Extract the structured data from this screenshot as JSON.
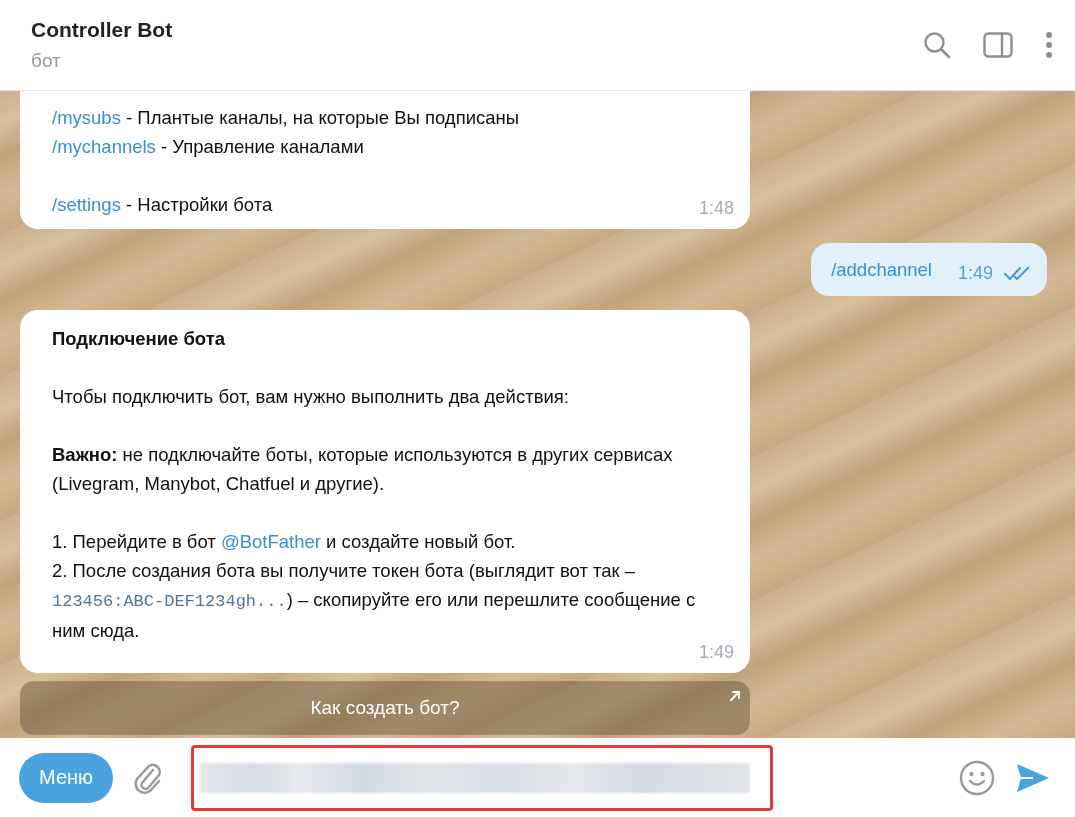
{
  "header": {
    "title": "Controller Bot",
    "subtitle": "бот"
  },
  "messages": [
    {
      "kind": "incoming",
      "paragraphs": [
        [
          {
            "kind": "command",
            "segments": [
              {
                "kind": "link",
                "text": "/mysubs"
              },
              {
                "kind": "text",
                "text": " - Плантые каналы, на которые Вы подписаны"
              }
            ]
          },
          {
            "kind": "command",
            "segments": [
              {
                "kind": "link",
                "text": "/mychannels"
              },
              {
                "kind": "text",
                "text": " - Управление каналами"
              }
            ]
          }
        ],
        [
          {
            "kind": "command",
            "segments": [
              {
                "kind": "link",
                "text": "/settings"
              },
              {
                "kind": "text",
                "text": " - Настройки бота"
              }
            ]
          }
        ]
      ],
      "time": "1:48",
      "continued": true
    },
    {
      "kind": "outgoing",
      "paragraphs": [
        [
          {
            "kind": "command",
            "segments": [
              {
                "kind": "link",
                "text": "/addchannel"
              }
            ]
          }
        ]
      ],
      "time": "1:49",
      "read": true,
      "continued": false
    },
    {
      "kind": "incoming",
      "title": "Подключение бота",
      "paragraphs": [
        [
          {
            "kind": "prose",
            "segments": [
              {
                "kind": "text",
                "text": "Чтобы подключить бот, вам нужно выполнить два действия:"
              }
            ]
          }
        ],
        [
          {
            "kind": "prose",
            "segments": [
              {
                "kind": "text",
                "text": "**Важно:** не подключайте боты, которые используются в других сервисах (Livegram, Manybot, Chatfuel и другие)."
              }
            ]
          }
        ],
        [
          {
            "kind": "prose",
            "segments": [
              {
                "kind": "text",
                "text": "1. Перейдите в бот "
              },
              {
                "kind": "link",
                "text": "@BotFather"
              },
              {
                "kind": "text",
                "text": " и создайте новый бот."
              }
            ]
          },
          {
            "kind": "prose",
            "segments": [
              {
                "kind": "text",
                "text": "2. После создания бота вы получите токен бота (выглядит вот так – "
              },
              {
                "kind": "code",
                "text": "123456:ABC-DEF1234gh..."
              },
              {
                "kind": "text",
                "text": ") – скопируйте его или перешлите сообщение с ним сюда."
              }
            ]
          }
        ]
      ],
      "time": "1:49",
      "buttons": [
        {
          "label": "Как создать бот?"
        }
      ],
      "continued": false
    }
  ],
  "composer": {
    "menu_button": "Меню",
    "highlighted": true
  }
}
